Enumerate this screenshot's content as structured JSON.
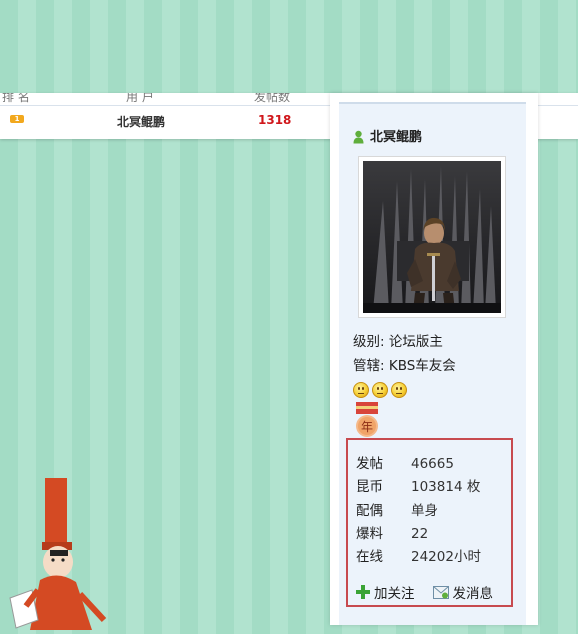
{
  "ranking_table": {
    "header_fragments": [
      "排 名",
      "用 户",
      "发帖数"
    ],
    "row": {
      "badge": "1",
      "name": "北冥鲲鹏",
      "count": "1318"
    }
  },
  "profile_card": {
    "username": "北冥鲲鹏",
    "level_line": "级别: 论坛版主",
    "manage_line": "管辖: KBS车友会",
    "medal_text": "年",
    "stats": [
      {
        "label": "发帖",
        "value": "46665"
      },
      {
        "label": "昆币",
        "value": "103814 枚"
      },
      {
        "label": "配偶",
        "value": "单身"
      },
      {
        "label": "爆料",
        "value": "22"
      },
      {
        "label": "在线",
        "value": "24202小时"
      }
    ],
    "actions": {
      "follow": "加关注",
      "message": "发消息"
    }
  },
  "icons": [
    "user-icon",
    "smiley-icon",
    "medal-icon",
    "plus-icon",
    "mail-icon"
  ],
  "colors": {
    "accent_red": "#d0171b",
    "box_border": "#c74a4f",
    "card_bg": "#ecf3fb",
    "page_stripe": "#a3dcc5"
  }
}
